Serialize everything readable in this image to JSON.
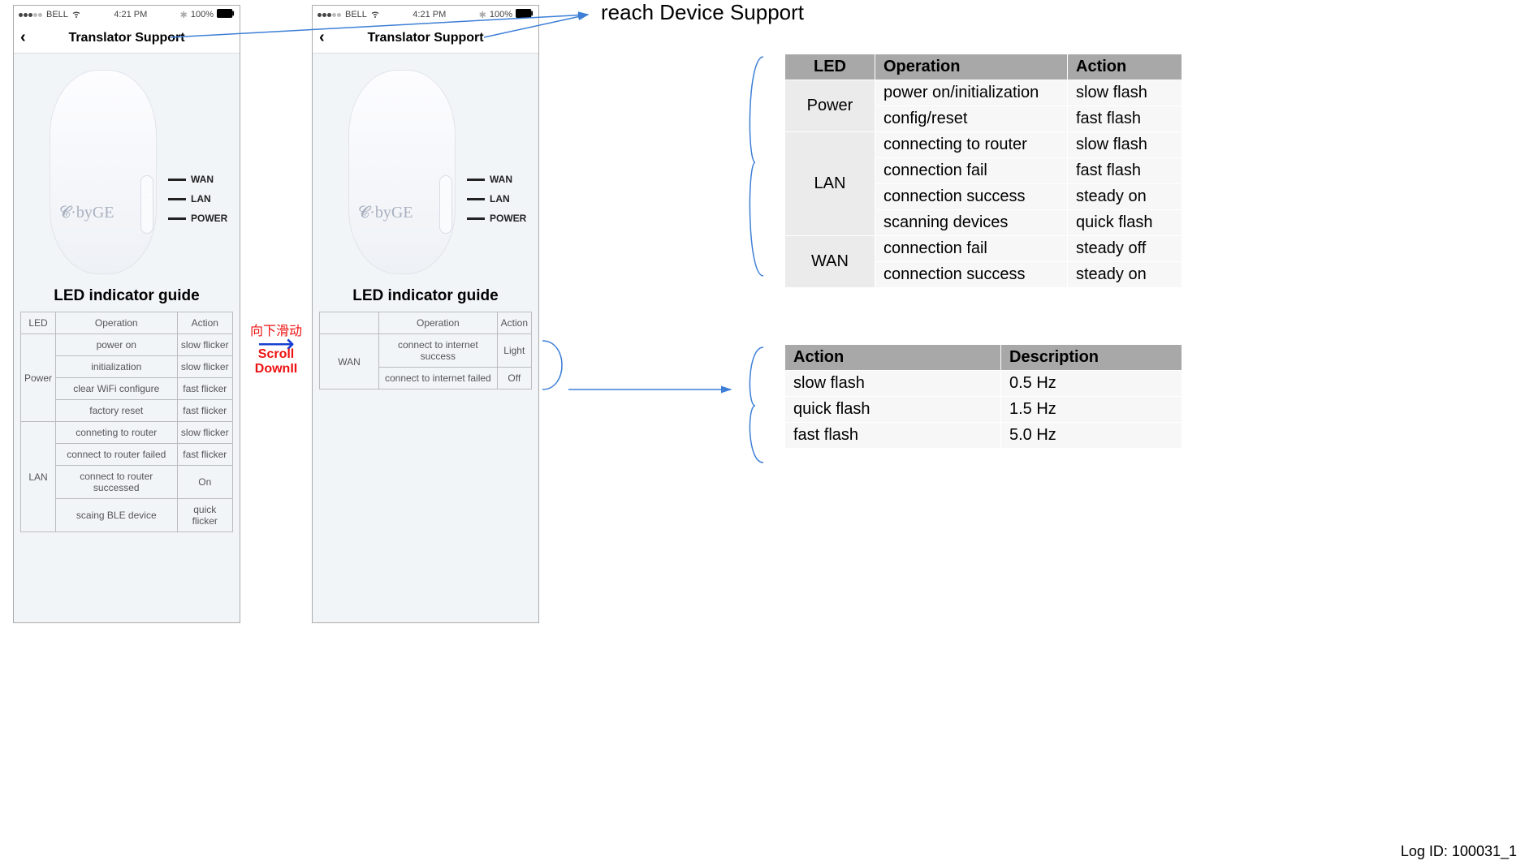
{
  "status": {
    "carrier": "BELL",
    "time": "4:21 PM",
    "battery": "100%"
  },
  "page_title": "Translator Support",
  "led_labels": {
    "wan": "WAN",
    "lan": "LAN",
    "power": "POWER"
  },
  "led_guide_title": "LED indicator guide",
  "phone1_table": {
    "headers": [
      "LED",
      "Operation",
      "Action"
    ],
    "groups": [
      {
        "led": "Power",
        "rows": [
          {
            "op": "power on",
            "act": "slow flicker"
          },
          {
            "op": "initialization",
            "act": "slow flicker"
          },
          {
            "op": "clear WiFi configure",
            "act": "fast flicker"
          },
          {
            "op": "factory reset",
            "act": "fast flicker"
          }
        ]
      },
      {
        "led": "LAN",
        "rows": [
          {
            "op": "conneting to router",
            "act": "slow flicker"
          },
          {
            "op": "connect to router failed",
            "act": "fast flicker"
          },
          {
            "op": "connect to router successed",
            "act": "On"
          },
          {
            "op": "scaing BLE device",
            "act": "quick flicker"
          }
        ]
      }
    ]
  },
  "phone2_table": {
    "headers": [
      "",
      "Operation",
      "Action"
    ],
    "groups": [
      {
        "led": "WAN",
        "rows": [
          {
            "op": "connect to internet success",
            "act": "Light"
          },
          {
            "op": "connect to internet failed",
            "act": "Off"
          }
        ]
      }
    ]
  },
  "scroll_anno": {
    "cn": "向下滑动",
    "en": "Scroll DownII"
  },
  "top_anno": "reach Device Support",
  "ref_table1": {
    "headers": [
      "LED",
      "Operation",
      "Action"
    ],
    "rows": [
      {
        "led": "Power",
        "op": "power on/initialization",
        "act": "slow flash"
      },
      {
        "led": "",
        "op": "config/reset",
        "act": "fast flash"
      },
      {
        "led": "LAN",
        "op": "connecting to router",
        "act": "slow flash"
      },
      {
        "led": "",
        "op": "connection fail",
        "act": "fast flash"
      },
      {
        "led": "",
        "op": "connection success",
        "act": "steady on"
      },
      {
        "led": "",
        "op": "scanning devices",
        "act": "quick flash"
      },
      {
        "led": "WAN",
        "op": "connection fail",
        "act": "steady off"
      },
      {
        "led": "",
        "op": "connection success",
        "act": "steady on"
      }
    ]
  },
  "ref_table2": {
    "headers": [
      "Action",
      "Description"
    ],
    "rows": [
      {
        "a": "slow flash",
        "d": "0.5 Hz"
      },
      {
        "a": "quick flash",
        "d": "1.5 Hz"
      },
      {
        "a": "fast flash",
        "d": "5.0 Hz"
      }
    ]
  },
  "log_id": "Log ID: 100031_1"
}
